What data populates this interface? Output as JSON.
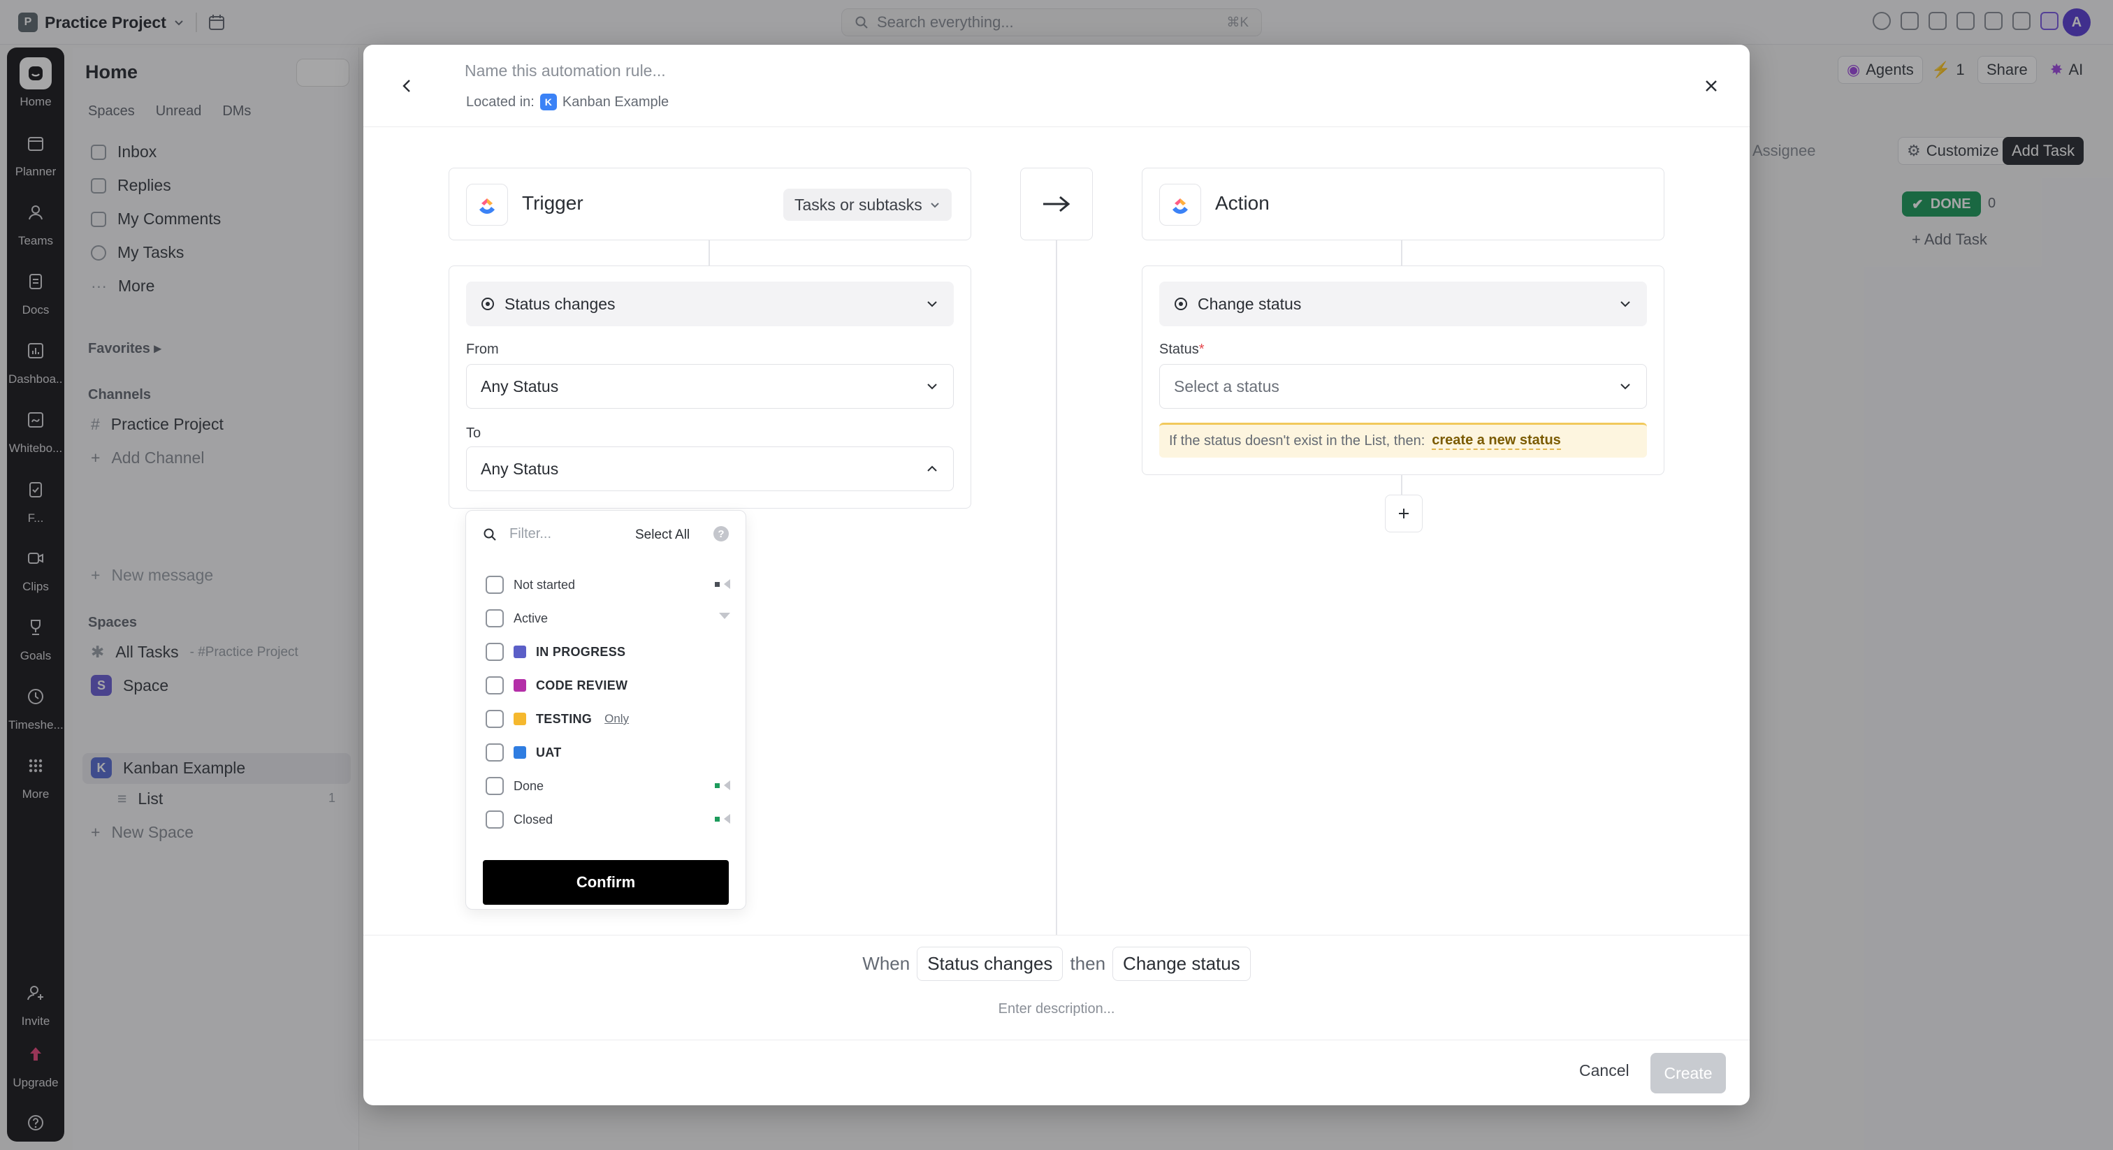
{
  "app": {
    "workspace_initial": "P",
    "workspace_name": "Practice Project",
    "search_placeholder": "Search everything...",
    "search_shortcut": "⌘K",
    "avatar_initial": "A"
  },
  "rail": [
    {
      "label": "Home",
      "icon": "home-icon"
    },
    {
      "label": "Planner",
      "icon": "planner-icon"
    },
    {
      "label": "Teams",
      "icon": "teams-icon"
    },
    {
      "label": "Docs",
      "icon": "docs-icon"
    },
    {
      "label": "Dashboa...",
      "icon": "dashboards-icon"
    },
    {
      "label": "Whitebo...",
      "icon": "whiteboards-icon"
    },
    {
      "label": "F...",
      "icon": "forms-icon"
    },
    {
      "label": "Clips",
      "icon": "clips-icon"
    },
    {
      "label": "Goals",
      "icon": "goals-icon"
    },
    {
      "label": "Timeshe...",
      "icon": "timesheets-icon"
    },
    {
      "label": "More",
      "icon": "more-icon"
    },
    {
      "label": "Invite",
      "icon": "invite-icon"
    },
    {
      "label": "Upgrade",
      "icon": "upgrade-icon"
    }
  ],
  "sidebar": {
    "title": "Home",
    "tabs": [
      "Spaces",
      "Unread",
      "DMs"
    ],
    "items": [
      "Inbox",
      "Replies",
      "My Comments",
      "My Tasks",
      "More"
    ],
    "favorites_label": "Favorites",
    "channels_label": "Channels",
    "channel_name": "Practice Project",
    "add_channel": "Add Channel",
    "new_message": "New message",
    "spaces_label": "Spaces",
    "all_tasks": "All Tasks",
    "all_tasks_sub": "- #Practice Project",
    "space": {
      "initial": "S",
      "name": "Space"
    },
    "kanban": {
      "initial": "K",
      "name": "Kanban Example"
    },
    "list": {
      "name": "List",
      "count": "1"
    },
    "new_space": "New Space"
  },
  "board": {
    "agents": "Agents",
    "bolt_count": "1",
    "share": "Share",
    "ai": "AI",
    "assignee": "Assignee",
    "customize": "Customize",
    "add_task_btn": "Add Task",
    "done_label": "DONE",
    "done_count": "0",
    "add_task_link": "Add Task"
  },
  "modal": {
    "name_placeholder": "Name this automation rule...",
    "located_in_label": "Located in:",
    "location_initial": "K",
    "location_name": "Kanban Example",
    "trigger": {
      "title": "Trigger",
      "scope": "Tasks or subtasks",
      "event": "Status changes",
      "from_label": "From",
      "from_value": "Any Status",
      "to_label": "To",
      "to_value": "Any Status"
    },
    "action": {
      "title": "Action",
      "event": "Change status",
      "status_label": "Status",
      "status_required": "*",
      "status_placeholder": "Select a status",
      "warning_text": "If the status doesn't exist in the List, then:",
      "warning_link": "create a new status"
    },
    "dropdown": {
      "filter_placeholder": "Filter...",
      "select_all": "Select All",
      "help": "?",
      "options": [
        {
          "label": "Not started",
          "style": "group"
        },
        {
          "label": "Active",
          "style": "group"
        },
        {
          "label": "IN PROGRESS",
          "style": "status",
          "color": "#5b5fc7"
        },
        {
          "label": "CODE REVIEW",
          "style": "status",
          "color": "#b42fa8"
        },
        {
          "label": "TESTING",
          "style": "status",
          "color": "#f5b82e",
          "extra": "Only"
        },
        {
          "label": "UAT",
          "style": "status",
          "color": "#2f7de1"
        },
        {
          "label": "Done",
          "style": "group"
        },
        {
          "label": "Closed",
          "style": "group"
        }
      ],
      "confirm": "Confirm"
    },
    "summary": {
      "when": "When",
      "trigger": "Status changes",
      "then": "then",
      "action": "Change status",
      "description_placeholder": "Enter description..."
    },
    "footer": {
      "cancel": "Cancel",
      "create": "Create"
    }
  }
}
